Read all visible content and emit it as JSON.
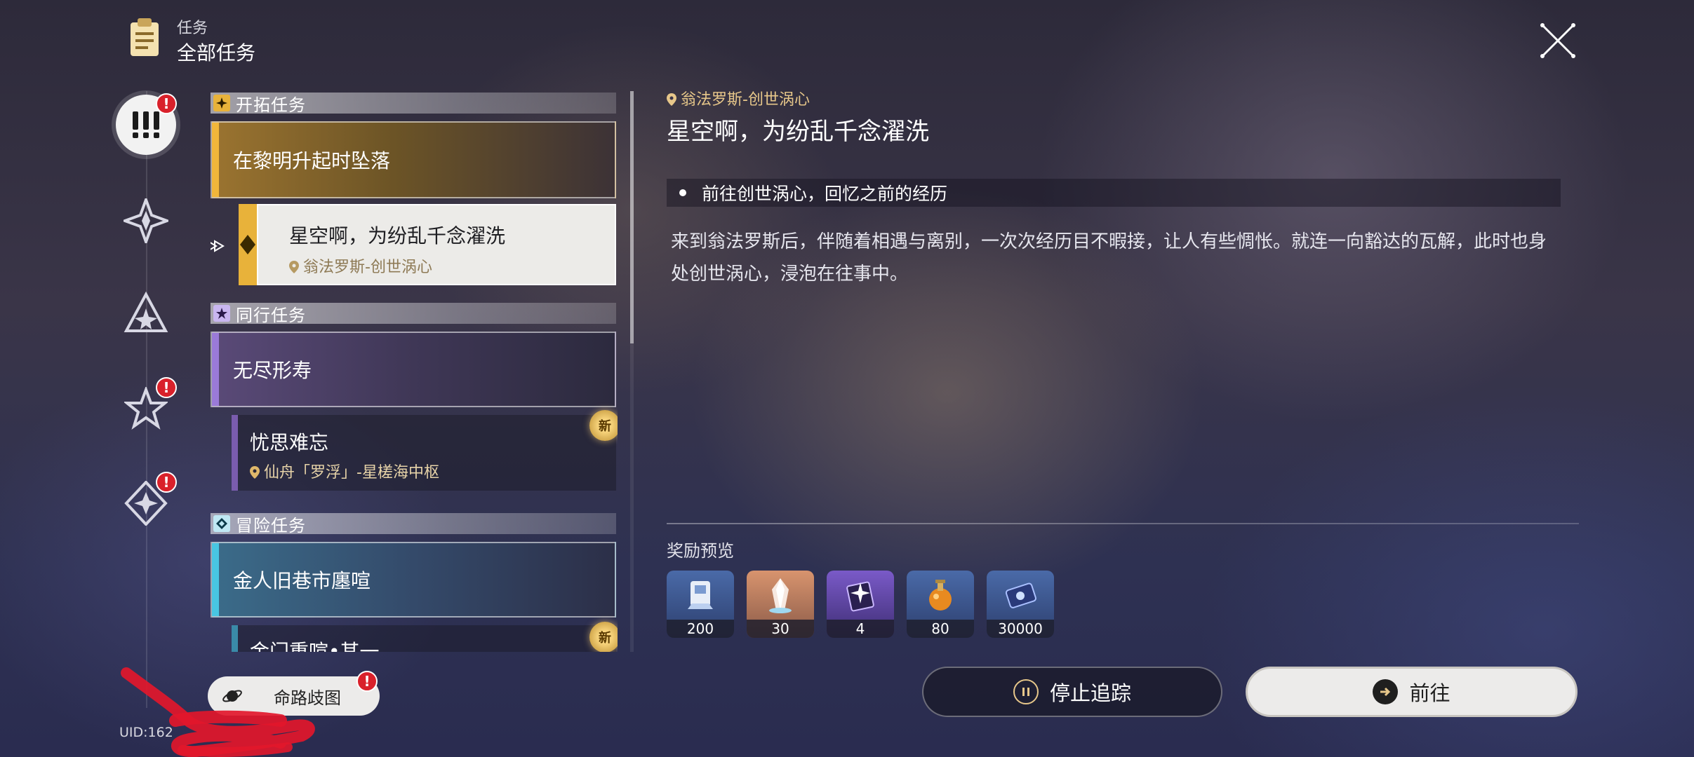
{
  "header": {
    "subtitle": "任务",
    "title": "全部任务",
    "icon": "clipboard-icon",
    "close_icon": "close-icon"
  },
  "rail": {
    "items": [
      {
        "name": "all-quests",
        "icon": "exclamation-icon",
        "active": true,
        "badge": "!"
      },
      {
        "name": "trailblaze-quests",
        "icon": "trailblaze-star-icon",
        "active": false,
        "badge": ""
      },
      {
        "name": "companion-quests",
        "icon": "triangle-star-icon",
        "active": false,
        "badge": ""
      },
      {
        "name": "adventure-quests",
        "icon": "star-icon",
        "active": false,
        "badge": "!"
      },
      {
        "name": "daily-quests",
        "icon": "diamond-star-icon",
        "active": false,
        "badge": "!"
      }
    ]
  },
  "list": {
    "sections": [
      {
        "label": "开拓任务",
        "color": "#e8b23a",
        "cards": [
          {
            "title": "在黎明升起时坠落"
          }
        ],
        "selected": {
          "title": "星空啊，为纷乱千念濯洗",
          "location": "翁法罗斯-创世涡心"
        }
      },
      {
        "label": "同行任务",
        "color": "#9a7ad8",
        "cards": [
          {
            "title": "无尽形寿"
          }
        ],
        "sub": {
          "title": "忧思难忘",
          "location": "仙舟「罗浮」-星槎海中枢",
          "badge": "新"
        }
      },
      {
        "label": "冒险任务",
        "color": "#48c6e2",
        "cards": [
          {
            "title": "金人旧巷市廛喧"
          }
        ],
        "sub": {
          "title": "金门重喧•其一",
          "badge": "新"
        }
      }
    ]
  },
  "detail": {
    "location": "翁法罗斯-创世涡心",
    "title": "星空啊，为纷乱千念濯洗",
    "objective": "前往创世涡心，回忆之前的经历",
    "description": "来到翁法罗斯后，伴随着相遇与离别，一次次经历目不暇接，让人有些惆怅。就连一向豁达的瓦解，此时也身处创世涡心，浸泡在往事中。",
    "reward_label": "奖励预览",
    "rewards": [
      {
        "icon": "trailblaze-exp-icon",
        "count": "200",
        "color": "#3a5a9a"
      },
      {
        "icon": "stellar-jade-icon",
        "count": "30",
        "color": "#c98a66"
      },
      {
        "icon": "lightcone-exp-icon",
        "count": "4",
        "color": "#6a4aa8"
      },
      {
        "icon": "potion-icon",
        "count": "80",
        "color": "#3a5a9a"
      },
      {
        "icon": "credit-icon",
        "count": "30000",
        "color": "#3a5a9a"
      }
    ]
  },
  "buttons": {
    "stop": "停止追踪",
    "go": "前往",
    "map": "命路歧图",
    "map_badge": "!"
  },
  "uid": "UID:162"
}
